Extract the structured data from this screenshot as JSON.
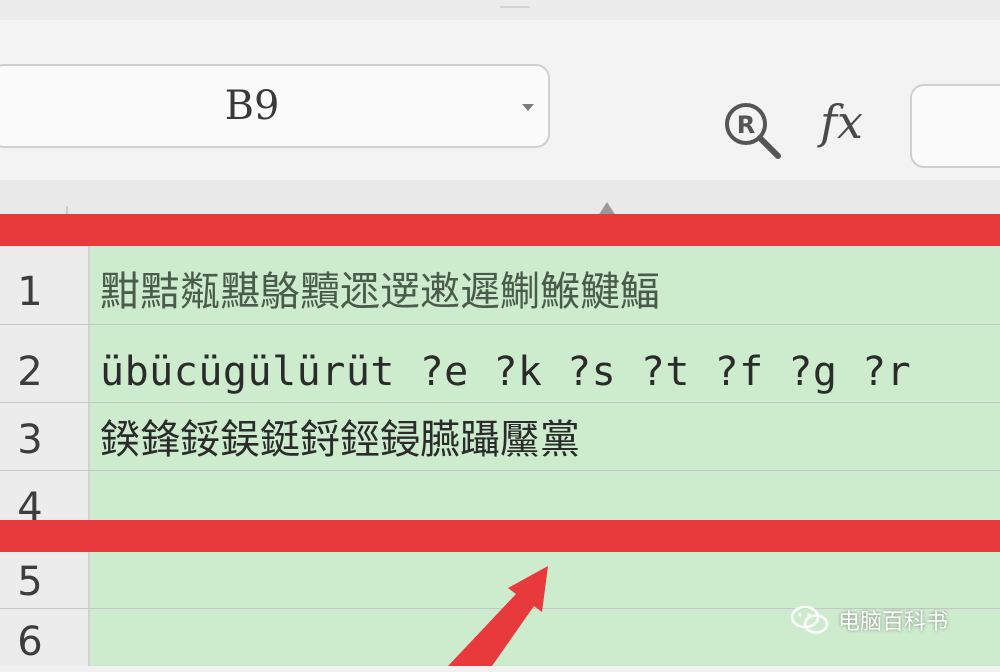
{
  "toolbar": {
    "name_box_value": "B9",
    "fx_label": "fx"
  },
  "rows": [
    {
      "num": "1",
      "text": "黚黠甐黮鴼黷遝遻遫遲鯯鯸鰎鰏"
    },
    {
      "num": "2",
      "text": "übücügülürüt ?e ?k ?s ?t ?f ?g ?r"
    },
    {
      "num": "3",
      "text": "鍨鋒鋖鋘鋌鋝鋞鋟臙躡黶黨"
    },
    {
      "num": "4",
      "text": ""
    },
    {
      "num": "5",
      "text": ""
    },
    {
      "num": "6",
      "text": ""
    }
  ],
  "watermark": {
    "text": "电脑百科书"
  },
  "colors": {
    "highlight_band": "#e8393c",
    "cell_fill": "#cdeccd",
    "arrow": "#e8393c"
  }
}
